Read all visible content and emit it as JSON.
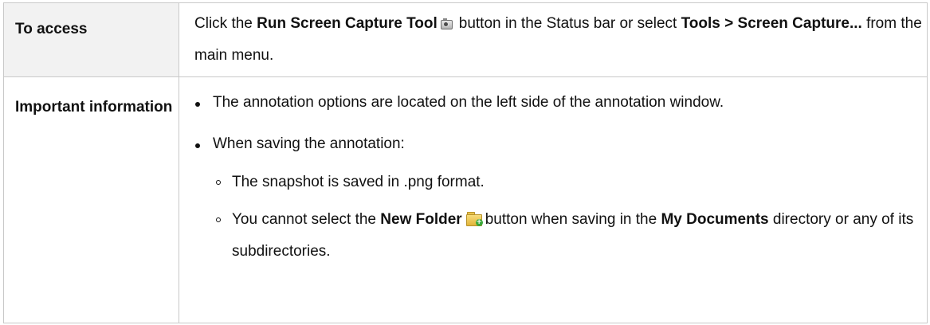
{
  "rows": [
    {
      "label": "To access",
      "text_click": "Click the",
      "bold_tool": "Run Screen Capture Tool",
      "text_after_icon": "button in the Status bar or select",
      "bold_menu": "Tools > Screen Capture...",
      "text_end": "from the main menu.",
      "icon": "camera-icon"
    },
    {
      "label": "Important information",
      "bullet1": "The annotation options are located on the left side of the annotation window.",
      "bullet2": "When saving the annotation:",
      "sub1": "The snapshot is saved in .png format.",
      "sub2_pre": "You cannot select the",
      "sub2_bold1": "New Folder",
      "sub2_mid": "button when saving in the",
      "sub2_bold2": "My Documents",
      "sub2_end": "directory or any of its subdirectories.",
      "icon": "new-folder-icon"
    }
  ],
  "colors": {
    "label_bg": "#f2f2f2",
    "border": "#c9c9c9"
  }
}
